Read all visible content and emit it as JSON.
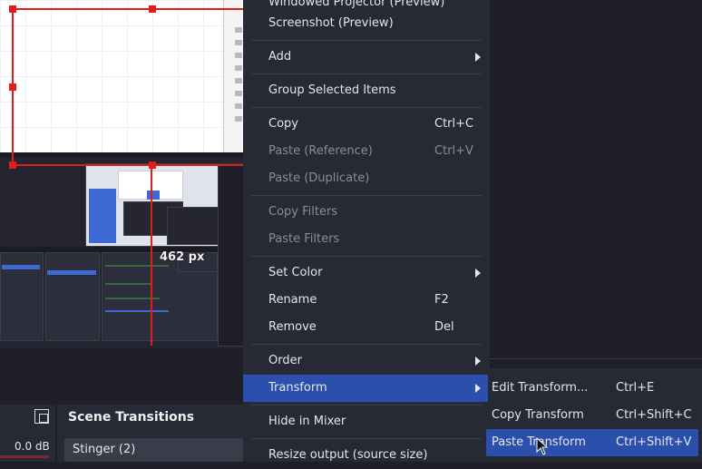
{
  "preview": {
    "size_label": "462 px"
  },
  "context_menu": {
    "items": [
      {
        "label": "Windowed Projector (Preview)",
        "shortcut": "",
        "disabled": false,
        "submenu": false
      },
      {
        "label": "Screenshot (Preview)",
        "shortcut": "",
        "disabled": false,
        "submenu": false
      },
      {
        "label": "Add",
        "shortcut": "",
        "disabled": false,
        "submenu": true
      },
      {
        "label": "Group Selected Items",
        "shortcut": "",
        "disabled": false,
        "submenu": false
      },
      {
        "label": "Copy",
        "shortcut": "Ctrl+C",
        "disabled": false,
        "submenu": false
      },
      {
        "label": "Paste (Reference)",
        "shortcut": "Ctrl+V",
        "disabled": true,
        "submenu": false
      },
      {
        "label": "Paste (Duplicate)",
        "shortcut": "",
        "disabled": true,
        "submenu": false
      },
      {
        "label": "Copy Filters",
        "shortcut": "",
        "disabled": true,
        "submenu": false
      },
      {
        "label": "Paste Filters",
        "shortcut": "",
        "disabled": true,
        "submenu": false
      },
      {
        "label": "Set Color",
        "shortcut": "",
        "disabled": false,
        "submenu": true
      },
      {
        "label": "Rename",
        "shortcut": "F2",
        "disabled": false,
        "submenu": false
      },
      {
        "label": "Remove",
        "shortcut": "Del",
        "disabled": false,
        "submenu": false
      },
      {
        "label": "Order",
        "shortcut": "",
        "disabled": false,
        "submenu": true
      },
      {
        "label": "Transform",
        "shortcut": "",
        "disabled": false,
        "submenu": true,
        "highlighted": true
      },
      {
        "label": "Hide in Mixer",
        "shortcut": "",
        "disabled": false,
        "submenu": false
      },
      {
        "label": "Resize output (source size)",
        "shortcut": "",
        "disabled": false,
        "submenu": false
      }
    ]
  },
  "transform_submenu": {
    "items": [
      {
        "label": "Edit Transform...",
        "shortcut": "Ctrl+E"
      },
      {
        "label": "Copy Transform",
        "shortcut": "Ctrl+Shift+C"
      },
      {
        "label": "Paste Transform",
        "shortcut": "Ctrl+Shift+V",
        "highlighted": true
      }
    ]
  },
  "audio_mixer": {
    "level": "0.0 dB"
  },
  "scene_transitions": {
    "title": "Scene Transitions",
    "selected": "Stinger (2)"
  },
  "colors": {
    "menu_bg": "#272935",
    "highlight": "#2c4fad",
    "selection_red": "#e01d1d",
    "disabled_text": "#8a8c97"
  }
}
